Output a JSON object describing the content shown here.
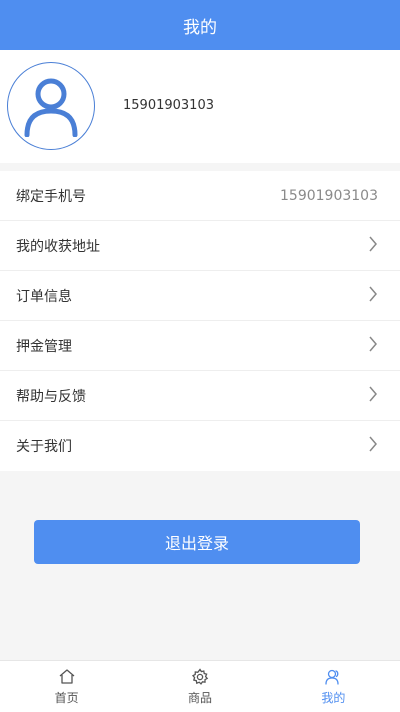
{
  "header": {
    "title": "我的"
  },
  "profile": {
    "phone": "15901903103",
    "avatar_icon": "user-avatar-icon"
  },
  "menu": {
    "bind_phone": {
      "label": "绑定手机号",
      "value": "15901903103"
    },
    "items": [
      {
        "label": "我的收获地址"
      },
      {
        "label": "订单信息"
      },
      {
        "label": "押金管理"
      },
      {
        "label": "帮助与反馈"
      },
      {
        "label": "关于我们"
      }
    ]
  },
  "logout": {
    "label": "退出登录"
  },
  "tabbar": {
    "items": [
      {
        "label": "首页",
        "icon": "home-icon"
      },
      {
        "label": "商品",
        "icon": "gear-icon"
      },
      {
        "label": "我的",
        "icon": "user-icon"
      }
    ],
    "active_color": "#4f8ef0"
  },
  "colors": {
    "primary": "#4f8ef0"
  }
}
